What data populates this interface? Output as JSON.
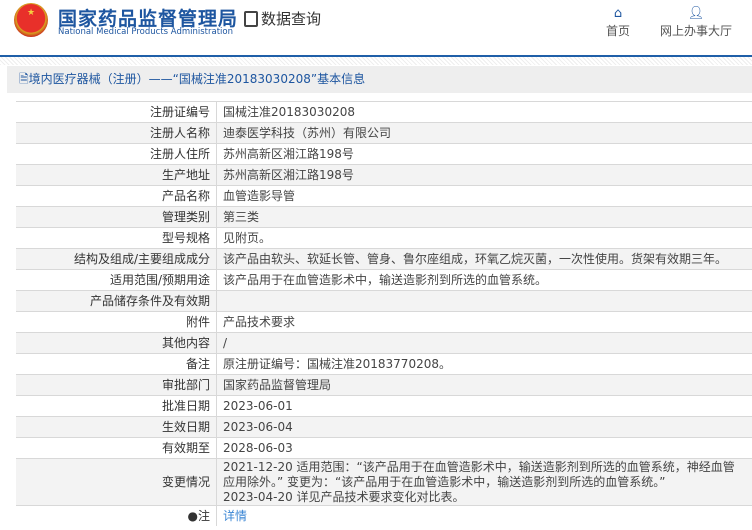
{
  "header": {
    "org_cn": "国家药品监督管理局",
    "org_en": "National Medical Products Administration",
    "query": "数据查询",
    "nav": [
      {
        "label": "首页",
        "icon": "home-icon"
      },
      {
        "label": "网上办事大厅",
        "icon": "user-icon"
      }
    ]
  },
  "title": "境内医疗器械（注册）——“国械注准20183030208”基本信息",
  "rows": [
    {
      "label": "注册证编号",
      "value": "国械注准20183030208"
    },
    {
      "label": "注册人名称",
      "value": "迪泰医学科技（苏州）有限公司"
    },
    {
      "label": "注册人住所",
      "value": "苏州高新区湘江路198号"
    },
    {
      "label": "生产地址",
      "value": "苏州高新区湘江路198号"
    },
    {
      "label": "产品名称",
      "value": "血管造影导管"
    },
    {
      "label": "管理类别",
      "value": "第三类"
    },
    {
      "label": "型号规格",
      "value": "见附页。"
    },
    {
      "label": "结构及组成/主要组成成分",
      "value": "该产品由软头、软延长管、管身、鲁尔座组成，环氧乙烷灭菌，一次性使用。货架有效期三年。"
    },
    {
      "label": "适用范围/预期用途",
      "value": "该产品用于在血管造影术中，输送造影剂到所选的血管系统。"
    },
    {
      "label": "产品储存条件及有效期",
      "value": ""
    },
    {
      "label": "附件",
      "value": "产品技术要求"
    },
    {
      "label": "其他内容",
      "value": "/"
    },
    {
      "label": "备注",
      "value": "原注册证编号：国械注准20183770208。"
    },
    {
      "label": "审批部门",
      "value": "国家药品监督管理局"
    },
    {
      "label": "批准日期",
      "value": "2023-06-01"
    },
    {
      "label": "生效日期",
      "value": "2023-06-04"
    },
    {
      "label": "有效期至",
      "value": "2028-06-03"
    }
  ],
  "changes": {
    "label": "变更情况",
    "lines": [
      "2021-12-20 适用范围：“该产品用于在血管造影术中，输送造影剂到所选的血管系统，神经血管应用除外。” 变更为：“该产品用于在血管造影术中，输送造影剂到所选的血管系统。”",
      "2023-04-20 详见产品技术要求变化对比表。"
    ]
  },
  "note": {
    "label": "注",
    "link": "详情"
  }
}
